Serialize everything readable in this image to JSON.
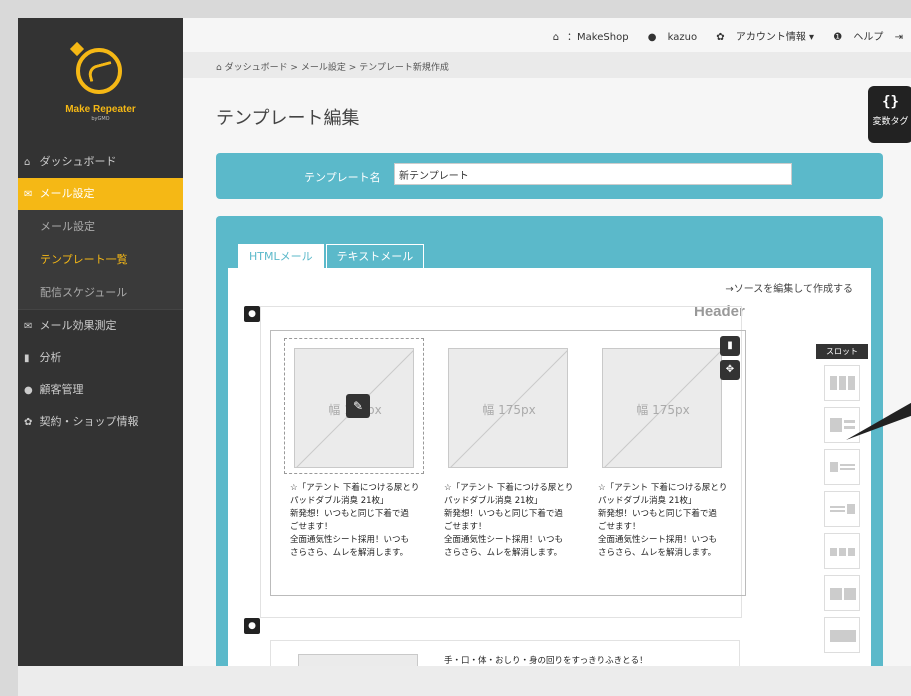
{
  "sidebar": {
    "logo_text": "Make Repeater",
    "logo_sub": "byGMO",
    "items": [
      {
        "icon": "home-icon",
        "glyph": "⌂",
        "label": "ダッシュボード"
      },
      {
        "icon": "mail-icon",
        "glyph": "✉",
        "label": "メール設定"
      }
    ],
    "subitems": [
      {
        "label": "メール設定"
      },
      {
        "label": "テンプレート一覧"
      },
      {
        "label": "配信スケジュール"
      }
    ],
    "group": [
      {
        "icon": "mail-icon",
        "glyph": "✉",
        "label": "メール効果測定"
      },
      {
        "icon": "chart-icon",
        "glyph": "▮",
        "label": "分析"
      },
      {
        "icon": "user-icon",
        "glyph": "●",
        "label": "顧客管理"
      },
      {
        "icon": "gear-icon",
        "glyph": "✿",
        "label": "契約・ショップ情報"
      }
    ]
  },
  "topbar": {
    "shop_label": "：MakeShop",
    "user": "kazuo",
    "account": "アカウント情報 ▾",
    "help": "ヘルプ"
  },
  "breadcrumb": "⌂ ダッシュボード > メール設定 > テンプレート新規作成",
  "page_title": "テンプレート編集",
  "var_tag": {
    "glyph": "{}",
    "label": "変数タグ"
  },
  "template_name": {
    "label": "テンプレート名",
    "value": "新テンプレート"
  },
  "tabs": [
    {
      "label": "HTMLメール"
    },
    {
      "label": "テキストメール"
    }
  ],
  "source_link": "→ソースを編集して作成する",
  "header_label": "Header",
  "image_width": "幅 175px",
  "product_desc": [
    "☆「アテント 下着につける尿とり",
    "パッドダブル消臭 21枚」",
    "新発想！いつもと同じ下着で過",
    "ごせます！",
    "全面通気性シート採用！いつも",
    "さらさら、ムレを解消します。"
  ],
  "block2_text": "手・口・体・おしり・身の回りをすっきりふきとる！",
  "slot_panel": {
    "title": "スロット"
  }
}
